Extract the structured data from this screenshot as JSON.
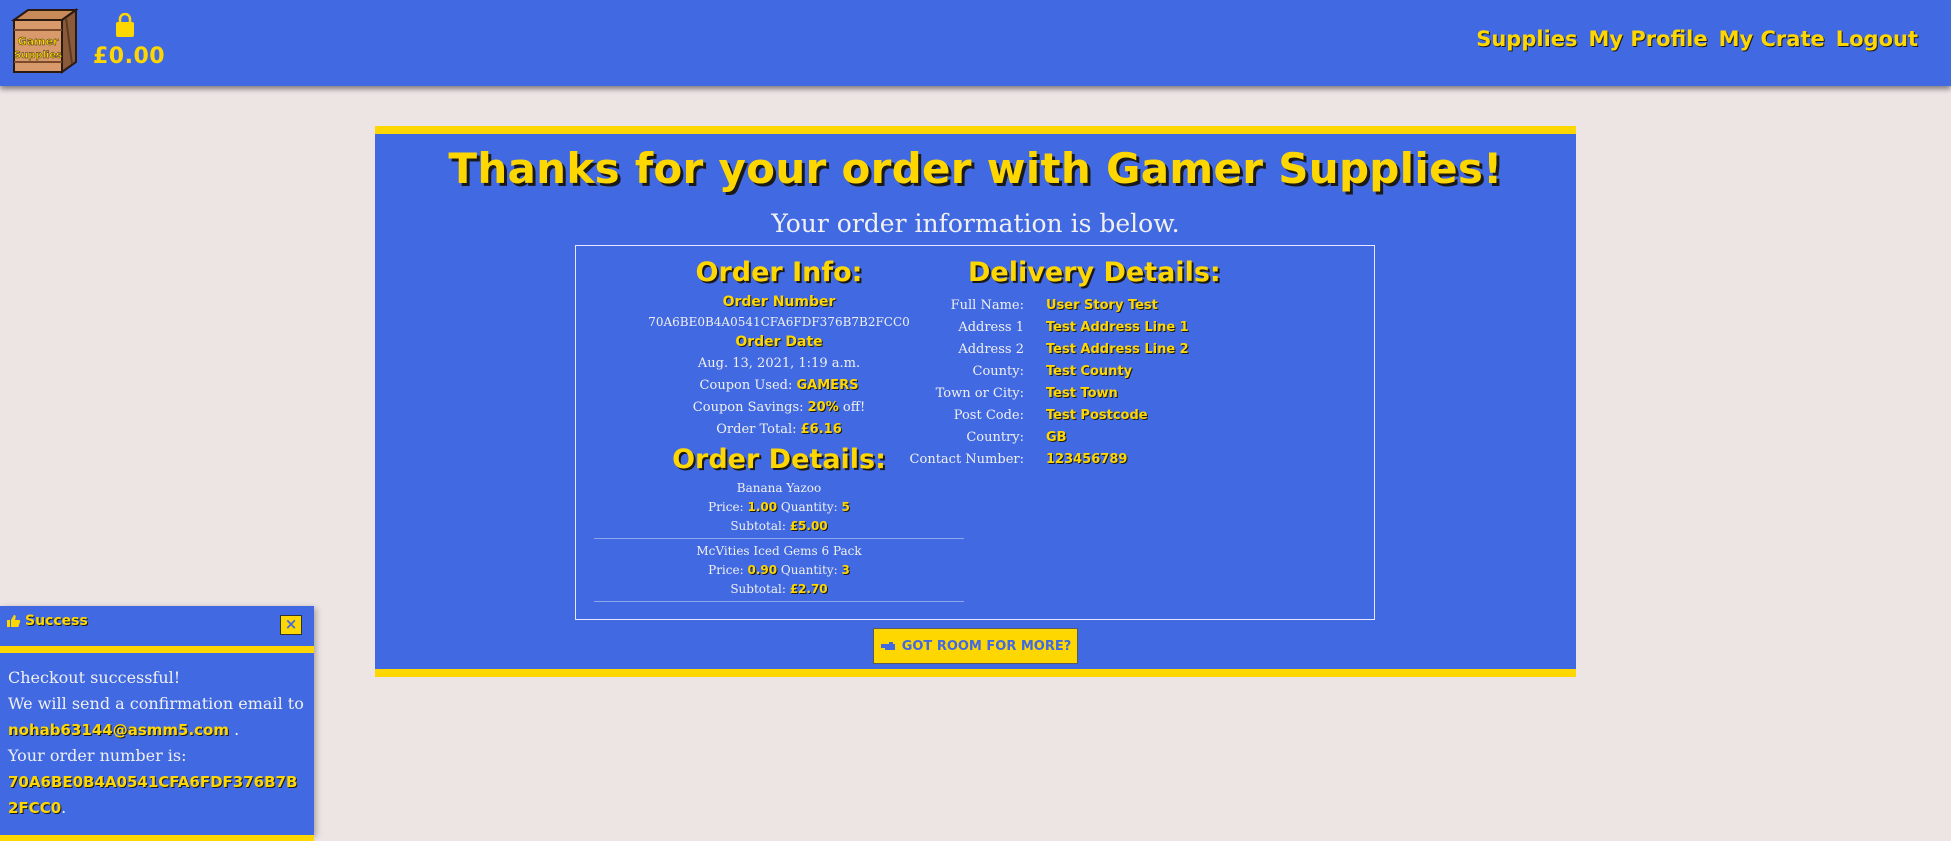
{
  "header": {
    "logo_text": "Gamer Supplies",
    "crate_total": "£0.00",
    "nav": [
      {
        "label": "Supplies"
      },
      {
        "label": "My Profile"
      },
      {
        "label": "My Crate"
      },
      {
        "label": "Logout"
      }
    ],
    "colors": {
      "primary": "#4169e1",
      "accent": "#ffd700",
      "background": "#ede4e4"
    }
  },
  "main": {
    "title": "Thanks for your order with Gamer Supplies!",
    "subtitle": "Your order information is below.",
    "order_info": {
      "heading": "Order Info:",
      "order_number_label": "Order Number",
      "order_number": "70A6BE0B4A0541CFA6FDF376B7B2FCC0",
      "order_date_label": "Order Date",
      "order_date": "Aug. 13, 2021, 1:19 a.m.",
      "coupon_used_label": "Coupon Used:",
      "coupon_used": "GAMERS",
      "coupon_savings_label": "Coupon Savings:",
      "coupon_savings": "20%",
      "coupon_savings_suffix": "off!",
      "order_total_label": "Order Total:",
      "order_total": "£6.16"
    },
    "order_details": {
      "heading": "Order Details:",
      "price_label": "Price:",
      "quantity_label": "Quantity:",
      "subtotal_label": "Subtotal:",
      "items": [
        {
          "name": "Banana Yazoo",
          "price": "1.00",
          "quantity": "5",
          "subtotal": "£5.00"
        },
        {
          "name": "McVities Iced Gems 6 Pack",
          "price": "0.90",
          "quantity": "3",
          "subtotal": "£2.70"
        }
      ]
    },
    "delivery": {
      "heading": "Delivery Details:",
      "rows": [
        {
          "label": "Full Name:",
          "value": "User Story Test"
        },
        {
          "label": "Address 1",
          "value": "Test Address Line 1"
        },
        {
          "label": "Address 2",
          "value": "Test Address Line 2"
        },
        {
          "label": "County:",
          "value": "Test County"
        },
        {
          "label": "Town or City:",
          "value": "Test Town"
        },
        {
          "label": "Post Code:",
          "value": "Test Postcode"
        },
        {
          "label": "Country:",
          "value": "GB"
        },
        {
          "label": "Contact Number:",
          "value": "123456789"
        }
      ]
    },
    "more_button": "GOT ROOM FOR MORE?"
  },
  "toast": {
    "title": "Success",
    "close": "×",
    "line1": "Checkout successful!",
    "line2": "We will send a confirmation email to",
    "email": "nohab63144@asmm5.com",
    "email_suffix": " .",
    "line3": "Your order number is:",
    "order_number": "70A6BE0B4A0541CFA6FDF376B7B2FCC0",
    "order_suffix": "."
  }
}
